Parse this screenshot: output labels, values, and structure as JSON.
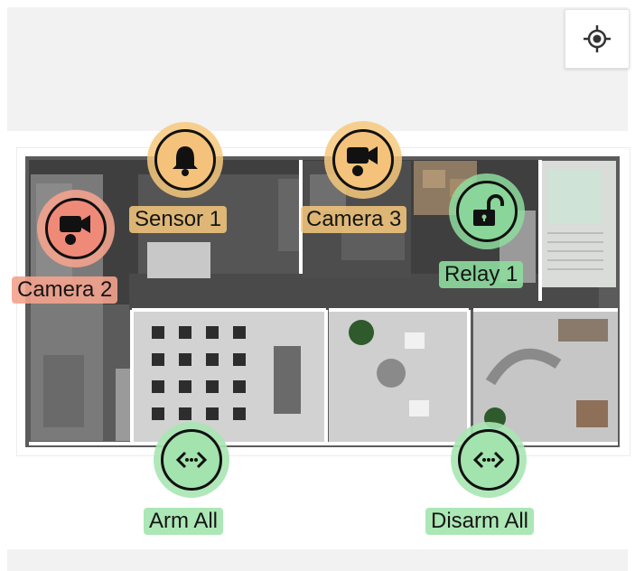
{
  "colors": {
    "sensor": "#f7c97e",
    "camera_active": "#f3a28d",
    "relay": "#8edc9f",
    "action": "#a8e6b2"
  },
  "toolbar": {
    "locate_icon": "crosshair-icon"
  },
  "markers": {
    "sensor1": {
      "label": "Sensor 1",
      "icon": "bell-icon"
    },
    "camera3": {
      "label": "Camera 3",
      "icon": "video-camera-icon"
    },
    "camera2": {
      "label": "Camera 2",
      "icon": "video-camera-icon"
    },
    "relay1": {
      "label": "Relay 1",
      "icon": "unlock-icon"
    }
  },
  "actions": {
    "arm_all": {
      "label": "Arm All",
      "icon": "code-arrows-icon"
    },
    "disarm_all": {
      "label": "Disarm All",
      "icon": "code-arrows-icon"
    }
  }
}
